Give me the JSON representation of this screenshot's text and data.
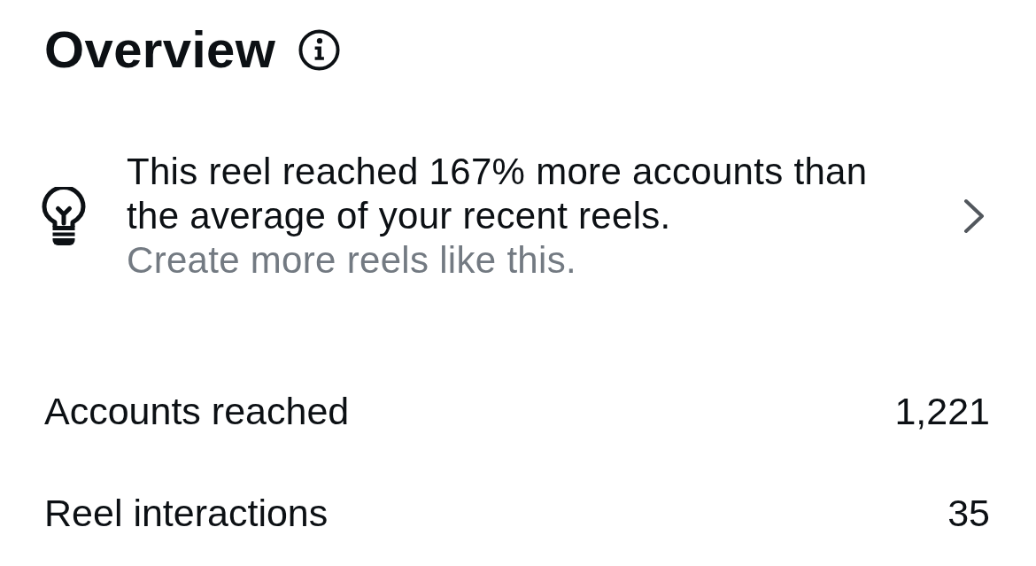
{
  "header": {
    "title": "Overview"
  },
  "insight": {
    "text": "This reel reached 167% more accounts than the average of your recent reels.",
    "action": "Create more reels like this."
  },
  "metrics": [
    {
      "label": "Accounts reached",
      "value": "1,221"
    },
    {
      "label": "Reel interactions",
      "value": "35"
    }
  ]
}
